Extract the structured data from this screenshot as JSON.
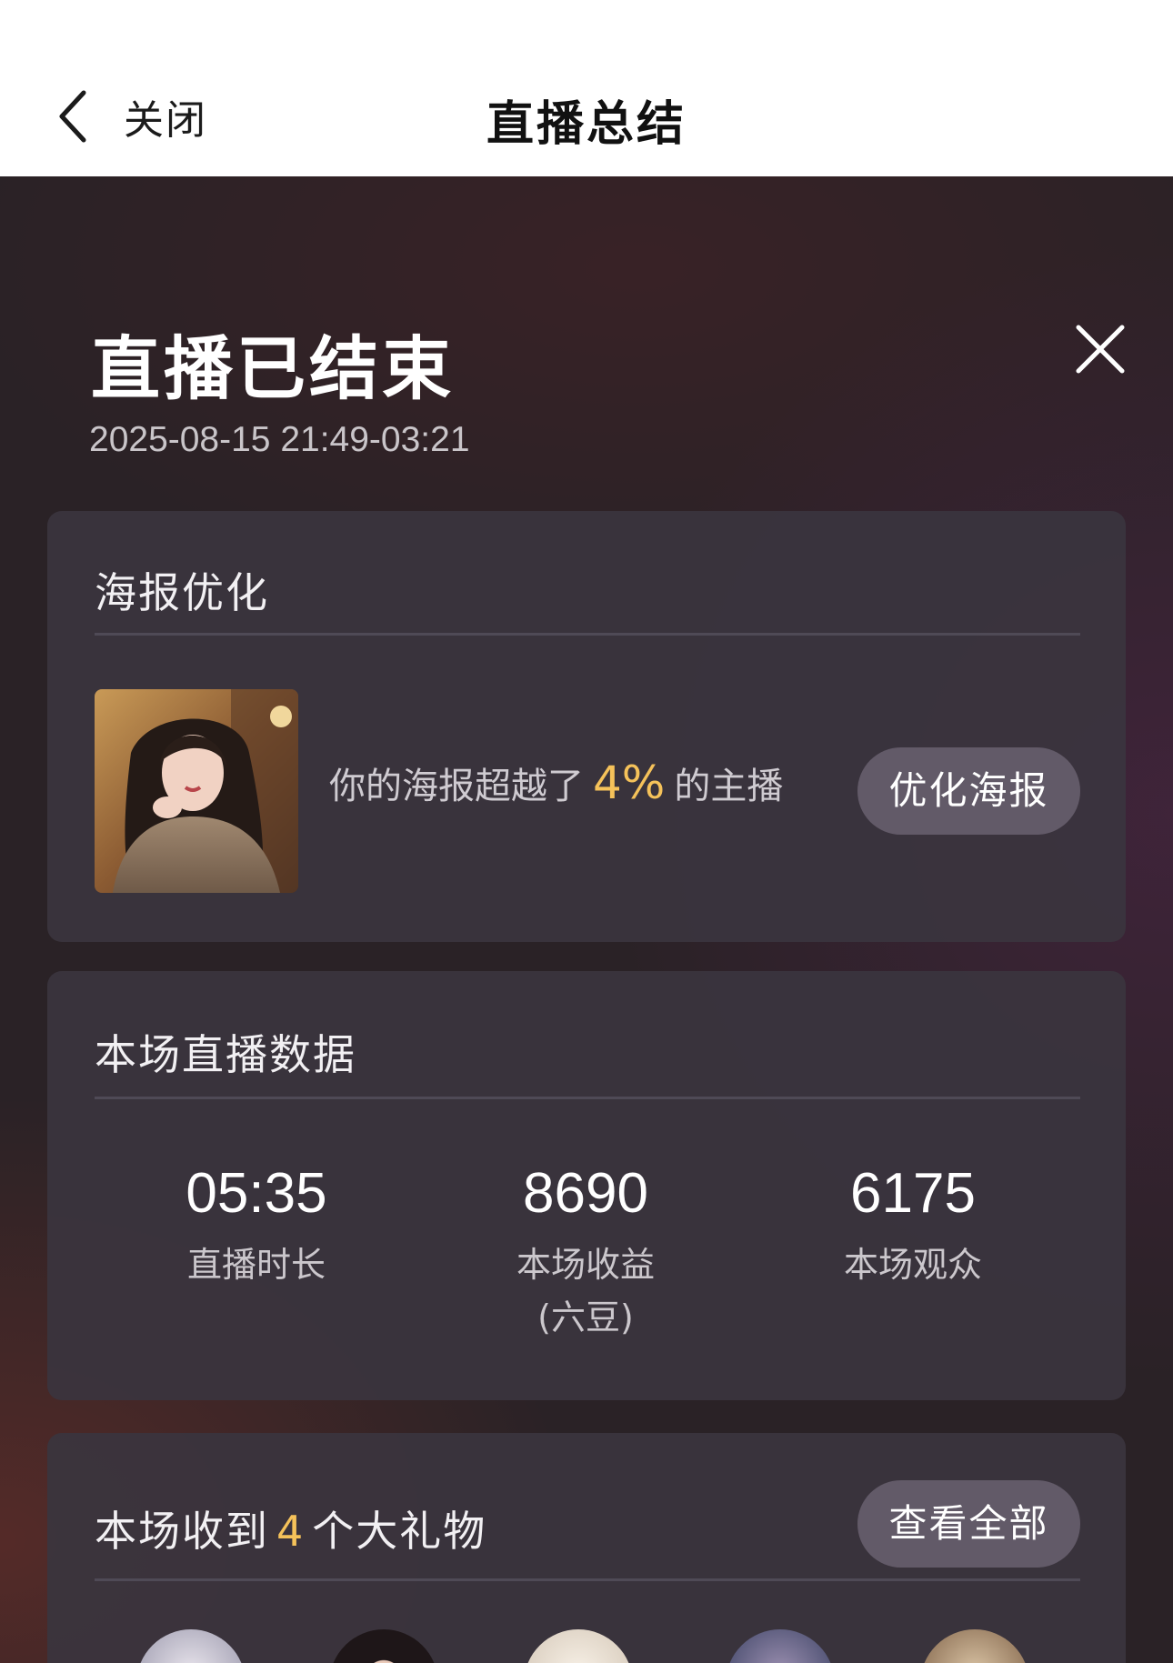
{
  "nav": {
    "back_label": "关闭",
    "title": "直播总结"
  },
  "summary": {
    "heading": "直播已结束",
    "time_range": "2025-08-15 21:49-03:21"
  },
  "poster": {
    "title": "海报优化",
    "text_before": "你的海报超越了",
    "percent": "4%",
    "text_after": "的主播",
    "button_label": "优化海报"
  },
  "stats": {
    "title": "本场直播数据",
    "items": [
      {
        "value": "05:35",
        "label": "直播时长",
        "sub": ""
      },
      {
        "value": "8690",
        "label": "本场收益",
        "sub": "(六豆)"
      },
      {
        "value": "6175",
        "label": "本场观众",
        "sub": ""
      }
    ]
  },
  "gifts": {
    "text_before": "本场收到",
    "count": "4",
    "text_after": "个大礼物",
    "button_label": "查看全部"
  },
  "colors": {
    "accent": "#f5c25a",
    "card_bg": "#3a353e",
    "pill_bg": "#625a68"
  }
}
